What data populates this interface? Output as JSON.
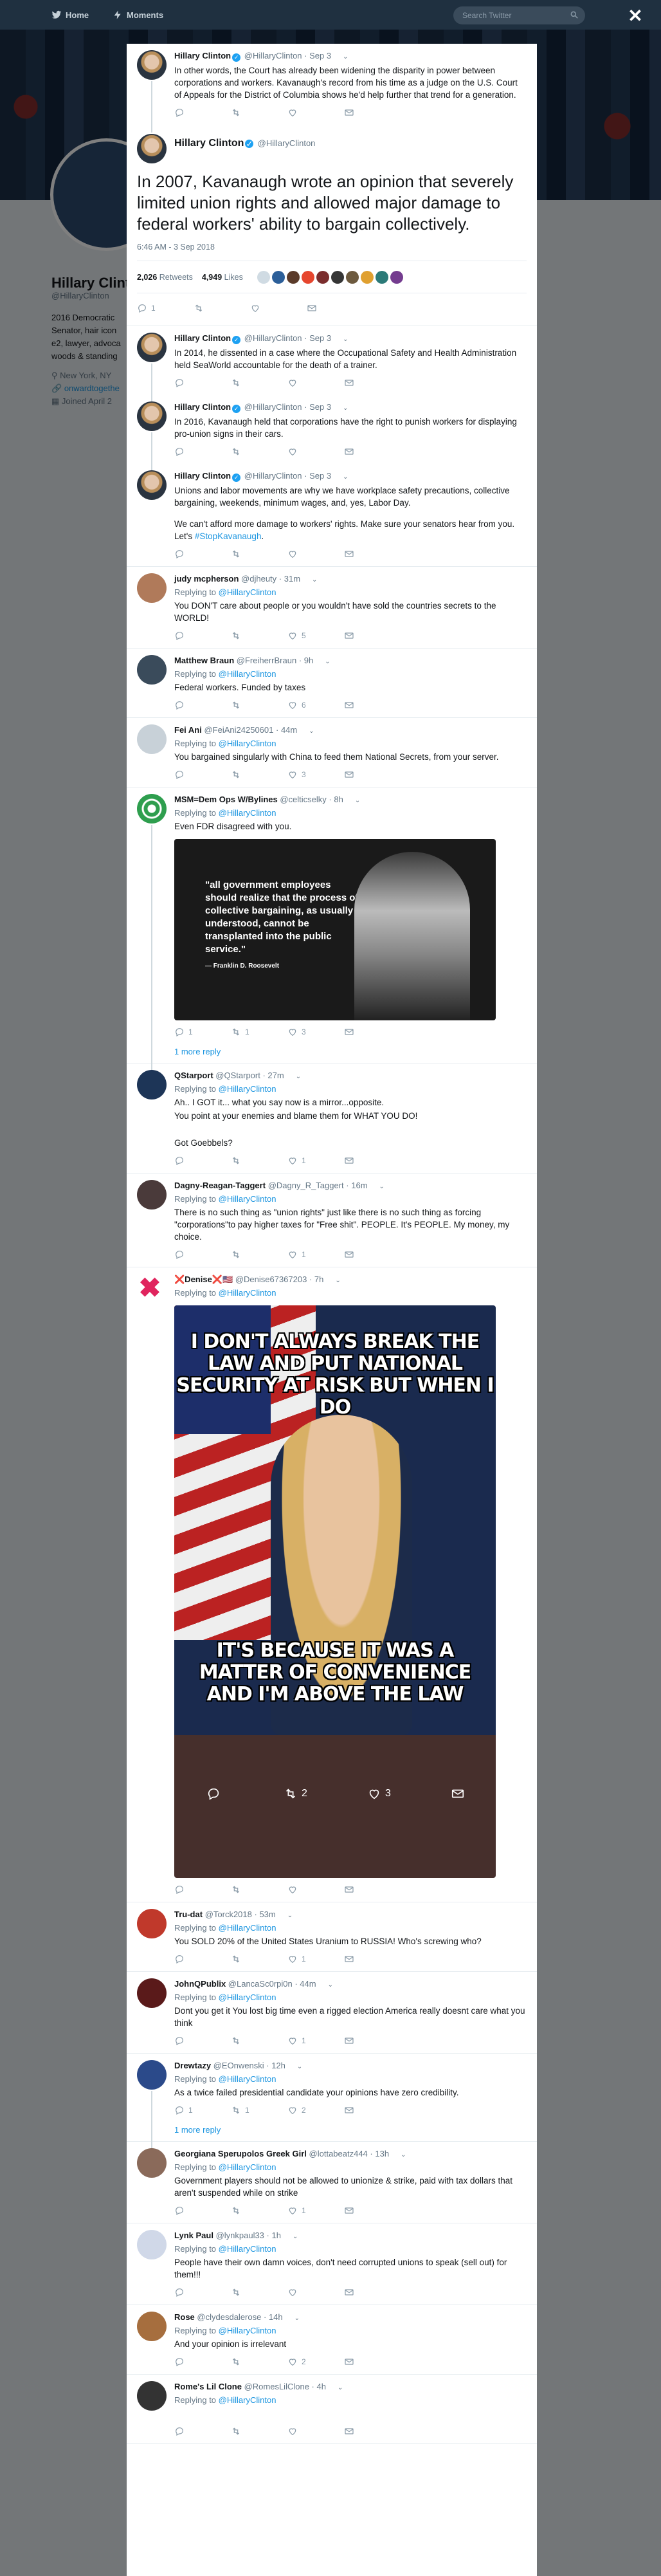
{
  "nav": {
    "home": "Home",
    "moments": "Moments",
    "search_placeholder": "Search Twitter"
  },
  "profile_ghost": {
    "name": "Hillary Clint",
    "handle": "@HillaryClinton",
    "bio": "2016 Democratic\nSenator, hair icon\ne2, lawyer, advoca\nwoods & standing",
    "location": "New York, NY",
    "link": "onwardtogethe",
    "joined": "Joined April 2"
  },
  "thread": [
    {
      "name": "Hillary Clinton",
      "handle": "@HillaryClinton",
      "time": "Sep 3",
      "text": "In other words, the Court has already been widening the disparity in power between corporations and workers. Kavanaugh's record from his time as a judge on the U.S. Court of Appeals for the District of Columbia shows he'd help further that trend for a generation."
    }
  ],
  "main_tweet": {
    "name": "Hillary Clinton",
    "handle": "@HillaryClinton",
    "text": "In 2007, Kavanaugh wrote an opinion that severely limited union rights and allowed major damage to federal workers' ability to bargain collectively.",
    "date": "6:46 AM - 3 Sep 2018",
    "retweets_count": "2,026",
    "retweets_label": "Retweets",
    "likes_count": "4,949",
    "likes_label": "Likes",
    "liker_colors": [
      "#d0dbe3",
      "#2c5f99",
      "#5b3b2a",
      "#e6462e",
      "#7b2d2d",
      "#363636",
      "#6d5a3f",
      "#e0a030",
      "#2b7a78",
      "#743c8f"
    ],
    "reply_count": "1"
  },
  "thread_after": [
    {
      "name": "Hillary Clinton",
      "handle": "@HillaryClinton",
      "time": "Sep 3",
      "text": "In 2014, he dissented in a case where the Occupational Safety and Health Administration held SeaWorld accountable for the death of a trainer."
    },
    {
      "name": "Hillary Clinton",
      "handle": "@HillaryClinton",
      "time": "Sep 3",
      "text": "In 2016, Kavanaugh held that corporations have the right to punish workers for displaying pro-union signs in their cars."
    },
    {
      "name": "Hillary Clinton",
      "handle": "@HillaryClinton",
      "time": "Sep 3",
      "text": "Unions and labor movements are why we have workplace safety precautions, collective bargaining, weekends, minimum wages, and, yes, Labor Day.",
      "text2": "We can't afford more damage to workers' rights. Make sure your senators hear from you. Let's",
      "hashtag": "#StopKavanaugh",
      "text3": "."
    }
  ],
  "replying_to_label": "Replying to",
  "replying_to_handle": "@HillaryClinton",
  "more_reply_label": "1 more reply",
  "replies": [
    {
      "name": "judy mcpherson",
      "handle": "@djheuty",
      "time": "31m",
      "text": "You DON'T care about people or you wouldn't have sold the countries secrets to the WORLD!",
      "reply": "",
      "rt": "",
      "like": "5",
      "av": "#b07a5a"
    },
    {
      "name": "Matthew Braun",
      "handle": "@FreiherrBraun",
      "time": "9h",
      "text": "Federal workers. Funded by taxes",
      "reply": "",
      "rt": "",
      "like": "6",
      "av": "#3a4b5b"
    },
    {
      "name": "Fei Ani",
      "handle": "@FeiAni24250601",
      "time": "44m",
      "text": "You bargained singularly with China to feed them National Secrets, from your server.",
      "reply": "",
      "rt": "",
      "like": "3",
      "av": "#c8d1d8"
    }
  ],
  "fdr_reply": {
    "name": "MSM=Dem Ops W/Bylines",
    "handle": "@celticselky",
    "time": "8h",
    "text": "Even FDR disagreed with you.",
    "quote": "\"all government employees should realize that the process of collective bargaining, as usually understood, cannot be transplanted into the public service.\"",
    "attrib": "— Franklin D. Roosevelt",
    "reply": "1",
    "rt": "1",
    "like": "3"
  },
  "replies2": [
    {
      "name": "QStarport",
      "handle": "@QStarport",
      "time": "27m",
      "lines": [
        "Ah.. I GOT it... what you say now is a mirror...opposite.",
        "You point at your enemies and blame them for WHAT YOU DO!",
        "",
        "Got Goebbels?"
      ],
      "reply": "",
      "rt": "",
      "like": "1",
      "av": "#1d3557"
    },
    {
      "name": "Dagny-Reagan-Taggert",
      "handle": "@Dagny_R_Taggert",
      "time": "16m",
      "lines": [
        "There is no such thing as \"union rights\" just like there is no such thing as forcing \"corporations\"to pay higher taxes for \"Free shit\". PEOPLE.  It's PEOPLE. My money, my choice."
      ],
      "reply": "",
      "rt": "",
      "like": "1",
      "av": "#4a3a3a"
    }
  ],
  "meme_reply": {
    "name": "❌Denise❌🇺🇸",
    "handle": "@Denise67367203",
    "time": "7h",
    "cap1": "I DON'T ALWAYS BREAK THE LAW AND PUT NATIONAL SECURITY AT RISK BUT WHEN I DO",
    "cap2": "IT'S BECAUSE IT WAS A MATTER OF CONVENIENCE AND I'M ABOVE THE LAW",
    "bar_rt": "2",
    "bar_like": "3"
  },
  "replies3": [
    {
      "name": "Tru-dat",
      "handle": "@Torck2018",
      "time": "53m",
      "lines": [
        "You SOLD 20% of the United States Uranium to RUSSIA!  Who's screwing who?"
      ],
      "reply": "",
      "rt": "",
      "like": "1",
      "av": "#c0392b"
    },
    {
      "name": "JohnQPublix",
      "handle": "@LancaSc0rpi0n",
      "time": "44m",
      "lines": [
        "Dont you get it You lost big time even a rigged election America really doesnt care what you think"
      ],
      "reply": "",
      "rt": "",
      "like": "1",
      "av": "#5a1a1a"
    },
    {
      "name": "Drewtazy",
      "handle": "@EOnwenski",
      "time": "12h",
      "lines": [
        "As a twice failed presidential candidate your opinions have zero credibility."
      ],
      "reply": "1",
      "rt": "1",
      "like": "2",
      "av": "#2b4a8a",
      "more": true
    },
    {
      "name": "Georgiana Sperupolos Greek Girl",
      "handle": "@lottabeatz444",
      "time": "13h",
      "lines": [
        "Government players should not be allowed to unionize & strike, paid with tax dollars that aren't suspended while on strike"
      ],
      "reply": "",
      "rt": "",
      "like": "1",
      "av": "#8a6a5a"
    },
    {
      "name": "Lynk Paul",
      "handle": "@lynkpaul33",
      "time": "1h",
      "lines": [
        "People have their own damn voices, don't need corrupted unions to speak (sell out) for them!!!"
      ],
      "reply": "",
      "rt": "",
      "like": "",
      "av": "#d0d8e8"
    },
    {
      "name": "Rose",
      "handle": "@clydesdalerose",
      "time": "14h",
      "lines": [
        "And your opinion is irrelevant"
      ],
      "reply": "",
      "rt": "",
      "like": "2",
      "av": "#a66e3e"
    },
    {
      "name": "Rome's Lil Clone",
      "handle": "@RomesLilClone",
      "time": "4h",
      "lines": [
        ""
      ],
      "reply": "",
      "rt": "",
      "like": "",
      "av": "#333"
    }
  ]
}
